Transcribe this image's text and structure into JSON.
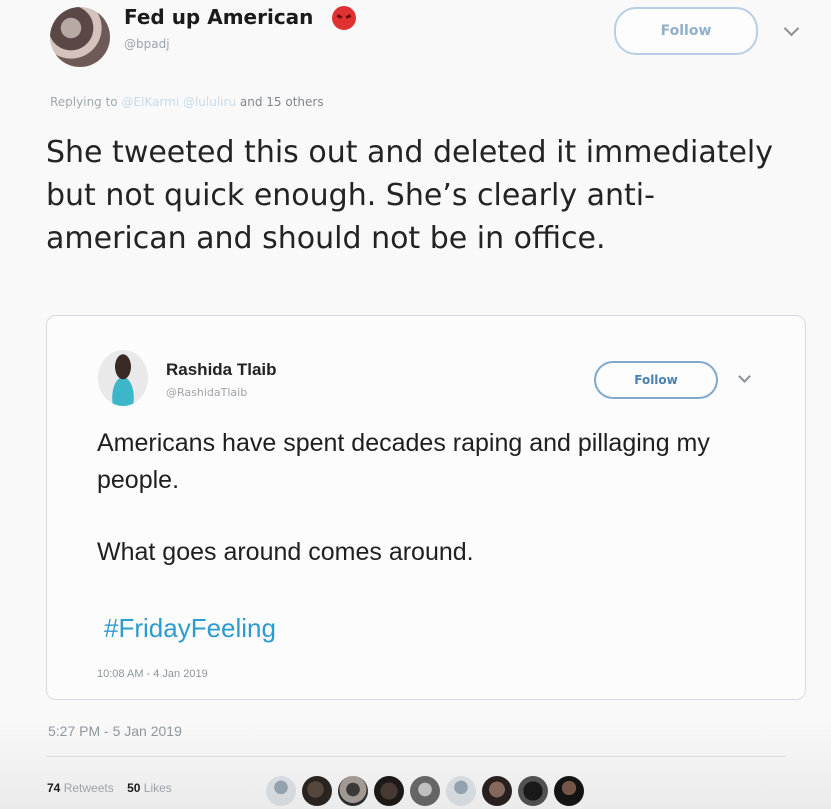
{
  "tweet": {
    "author": {
      "name": "Fed up American",
      "handle": "@bpadj",
      "emoji": "angry-face-icon"
    },
    "follow_label": "Follow",
    "reply": {
      "prefix": "Replying to",
      "mentions": "@ElKarmi @lululiru",
      "others": "and 15 others"
    },
    "text": "She tweeted this out and deleted it immediately but not quick enough. She’s clearly anti-american and should not be in office.",
    "timestamp": "5:27 PM - 5 Jan 2019",
    "stats": {
      "retweets_count": "74",
      "retweets_label": "Retweets",
      "likes_count": "50",
      "likes_label": "Likes"
    }
  },
  "quoted": {
    "author": {
      "name": "Rashida Tlaib",
      "handle": "@RashidaTlaib"
    },
    "follow_label": "Follow",
    "paragraph1": "Americans have spent decades raping and pillaging my people.",
    "paragraph2": "What goes around comes around.",
    "hashtag": "#FridayFeeling",
    "timestamp": "10:08 AM - 4 Jan 2019"
  },
  "colors": {
    "hashtag": "#2c9bd0",
    "follow_border": "#b8cfe3",
    "angry_emoji": "#e03232"
  },
  "likers": [
    "liker-avatar-1",
    "liker-avatar-2",
    "liker-avatar-3",
    "liker-avatar-4",
    "liker-avatar-5",
    "liker-avatar-6",
    "liker-avatar-7",
    "liker-avatar-8",
    "liker-avatar-9"
  ]
}
